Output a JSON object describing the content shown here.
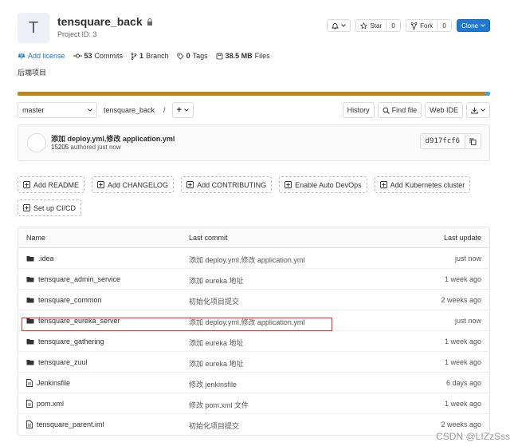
{
  "project": {
    "avatar_letter": "T",
    "name": "tensquare_back",
    "project_id": "Project ID: 3",
    "description": "后端项目"
  },
  "header_actions": {
    "notify_count": "",
    "star_label": "Star",
    "star_count": "0",
    "fork_label": "Fork",
    "fork_count": "0",
    "clone_label": "Clone"
  },
  "stats": {
    "add_license": "Add license",
    "commits_count": "53",
    "commits_label": "Commits",
    "branch_count": "1",
    "branch_label": "Branch",
    "tags_count": "0",
    "tags_label": "Tags",
    "files_size": "38.5 MB",
    "files_label": "Files"
  },
  "colors": {
    "lang_primary": "#c0841a",
    "lang_secondary": "#3fa8e0",
    "accent": "#1f78d1",
    "highlight": "#e03030"
  },
  "toolbar": {
    "branch": "master",
    "path": "tensquare_back",
    "separator": "/",
    "add_label": "+",
    "history": "History",
    "find_file": "Find file",
    "web_ide": "Web IDE"
  },
  "last_commit": {
    "title": "添加 deploy.yml,修改 application.yml",
    "author": "15205",
    "meta": "authored just now",
    "sha": "d917fcf6"
  },
  "add_buttons": [
    "Add README",
    "Add CHANGELOG",
    "Add CONTRIBUTING",
    "Enable Auto DevOps",
    "Add Kubernetes cluster",
    "Set up CI/CD"
  ],
  "tree": {
    "columns": {
      "name": "Name",
      "last_commit": "Last commit",
      "last_update": "Last update"
    },
    "rows": [
      {
        "type": "folder",
        "name": ".idea",
        "commit": "添加 deploy.yml,修改 application.yml",
        "updated": "just now"
      },
      {
        "type": "folder",
        "name": "tensquare_admin_service",
        "commit": "添加 eureka 地址",
        "updated": "1 week ago"
      },
      {
        "type": "folder",
        "name": "tensquare_common",
        "commit": "初始化项目提交",
        "updated": "2 weeks ago"
      },
      {
        "type": "folder",
        "name": "tensquare_eureka_server",
        "commit": "添加 deploy.yml,修改 application.yml",
        "updated": "just now"
      },
      {
        "type": "folder",
        "name": "tensquare_gathering",
        "commit": "添加 eureka 地址",
        "updated": "1 week ago"
      },
      {
        "type": "folder",
        "name": "tensquare_zuul",
        "commit": "添加 eureka 地址",
        "updated": "1 week ago"
      },
      {
        "type": "file",
        "name": "Jenkinsfile",
        "commit": "修改 jenkinsfile",
        "updated": "6 days ago"
      },
      {
        "type": "file",
        "name": "pom.xml",
        "commit": "修改 pom.xml 文件",
        "updated": "1 week ago"
      },
      {
        "type": "file",
        "name": "tensquare_parent.iml",
        "commit": "初始化项目提交",
        "updated": "2 weeks ago"
      }
    ]
  },
  "watermark": "CSDN @LIZzSss"
}
